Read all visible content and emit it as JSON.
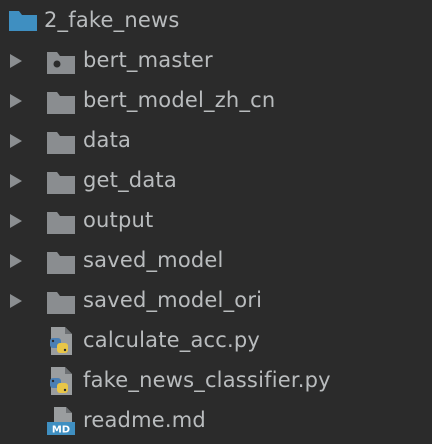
{
  "project_tree": {
    "root": {
      "name": "2_fake_news",
      "icon": "folder-icon"
    },
    "items": [
      {
        "name": "bert_master",
        "type": "folder",
        "expandable": true,
        "icon": "module-folder-icon"
      },
      {
        "name": "bert_model_zh_cn",
        "type": "folder",
        "expandable": true,
        "icon": "folder-icon"
      },
      {
        "name": "data",
        "type": "folder",
        "expandable": true,
        "icon": "folder-icon"
      },
      {
        "name": "get_data",
        "type": "folder",
        "expandable": true,
        "icon": "folder-icon"
      },
      {
        "name": "output",
        "type": "folder",
        "expandable": true,
        "icon": "folder-icon"
      },
      {
        "name": "saved_model",
        "type": "folder",
        "expandable": true,
        "icon": "folder-icon"
      },
      {
        "name": "saved_model_ori",
        "type": "folder",
        "expandable": true,
        "icon": "folder-icon"
      },
      {
        "name": "calculate_acc.py",
        "type": "python-file",
        "expandable": false,
        "icon": "python-file-icon"
      },
      {
        "name": "fake_news_classifier.py",
        "type": "python-file",
        "expandable": false,
        "icon": "python-file-icon"
      },
      {
        "name": "readme.md",
        "type": "markdown-file",
        "expandable": false,
        "icon": "markdown-file-icon",
        "icon_text": "MD"
      }
    ]
  },
  "colors": {
    "background": "#2b2b2b",
    "text": "#b9bcbe",
    "root_folder": "#3f8fc1",
    "folder": "#8a8d90",
    "arrow": "#8b8e91",
    "python_blue": "#4a7fb5",
    "python_yellow": "#e9c647",
    "markdown_blue": "#3f8fc1"
  }
}
